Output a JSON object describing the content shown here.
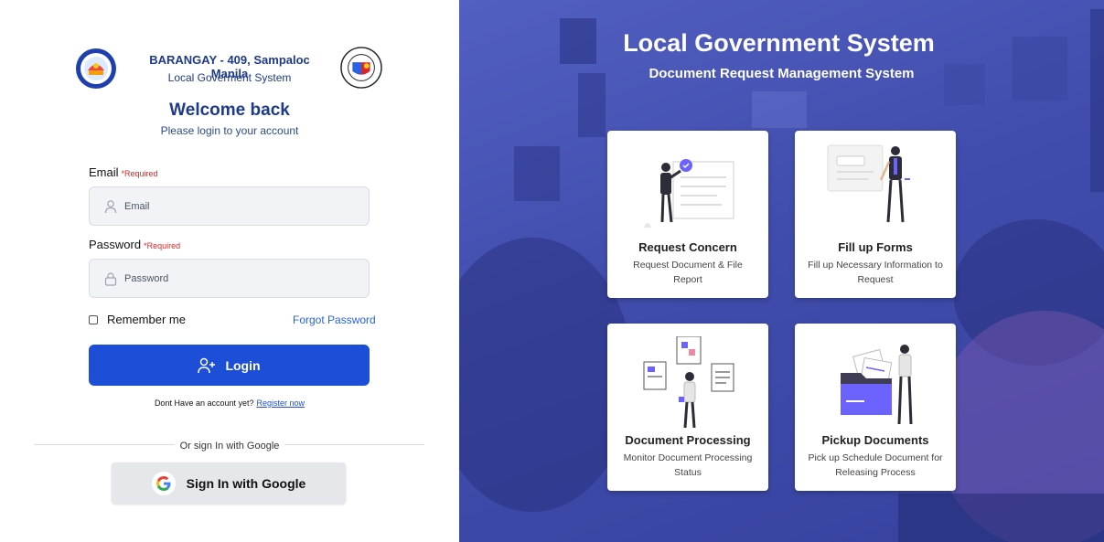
{
  "login": {
    "brand_title": "BARANGAY - 409, Sampaloc Manila",
    "brand_subtitle": "Local Goverment System",
    "welcome": "Welcome back",
    "welcome_sub": "Please login to your account",
    "email_label": "Email",
    "email_required": "*Required",
    "email_placeholder": "Email",
    "password_label": "Password",
    "password_required": "*Required",
    "password_placeholder": "Password",
    "remember_label": "Remember me",
    "forgot_label": "Forgot Password",
    "login_label": "Login",
    "register_prompt": "Dont Have an account yet?",
    "register_link": "Register now",
    "divider_text": "Or sign In with Google",
    "google_label": "Sign In with Google"
  },
  "hero": {
    "title": "Local Government System",
    "subtitle": "Document Request Management System",
    "cards": [
      {
        "title": "Request Concern",
        "desc": "Request Document & File Report"
      },
      {
        "title": "Fill up Forms",
        "desc": "Fill up Necessary Information to Request"
      },
      {
        "title": "Document Processing",
        "desc": "Monitor Document Processing Status"
      },
      {
        "title": "Pickup Documents",
        "desc": "Pick up Schedule Document for Releasing Process"
      }
    ]
  },
  "colors": {
    "primary": "#1d4ed8",
    "brand_text": "#1e3a8a",
    "required": "#dc2626",
    "overlay": "#3f4aa8",
    "illustration_accent": "#6c63ff"
  },
  "icons": [
    "barangay-seal-icon",
    "manila-seal-icon",
    "user-icon",
    "lock-icon",
    "user-plus-icon",
    "google-icon"
  ]
}
